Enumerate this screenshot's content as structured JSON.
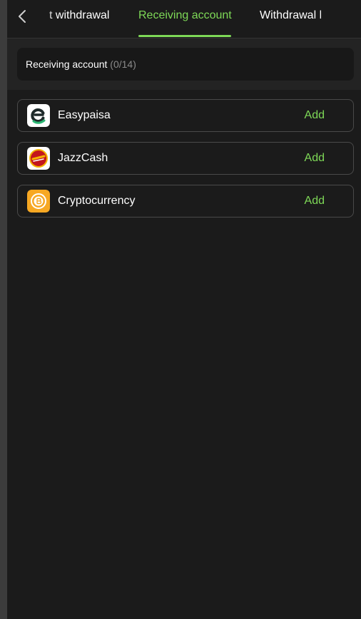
{
  "tabs": [
    {
      "label": "t withdrawal",
      "active": false
    },
    {
      "label": "Receiving account",
      "active": true
    },
    {
      "label": "Withdrawal l",
      "active": false
    }
  ],
  "header": {
    "title": "Receiving account",
    "count": "(0/14)"
  },
  "accounts": [
    {
      "name": "Easypaisa",
      "action": "Add",
      "icon": "easypaisa-icon"
    },
    {
      "name": "JazzCash",
      "action": "Add",
      "icon": "jazzcash-icon"
    },
    {
      "name": "Cryptocurrency",
      "action": "Add",
      "icon": "bitcoin-icon"
    }
  ],
  "colors": {
    "accent": "#7ed957",
    "background": "#1b1b1b",
    "card_border": "#4a4a4a",
    "muted_text": "#8a8a8a"
  }
}
